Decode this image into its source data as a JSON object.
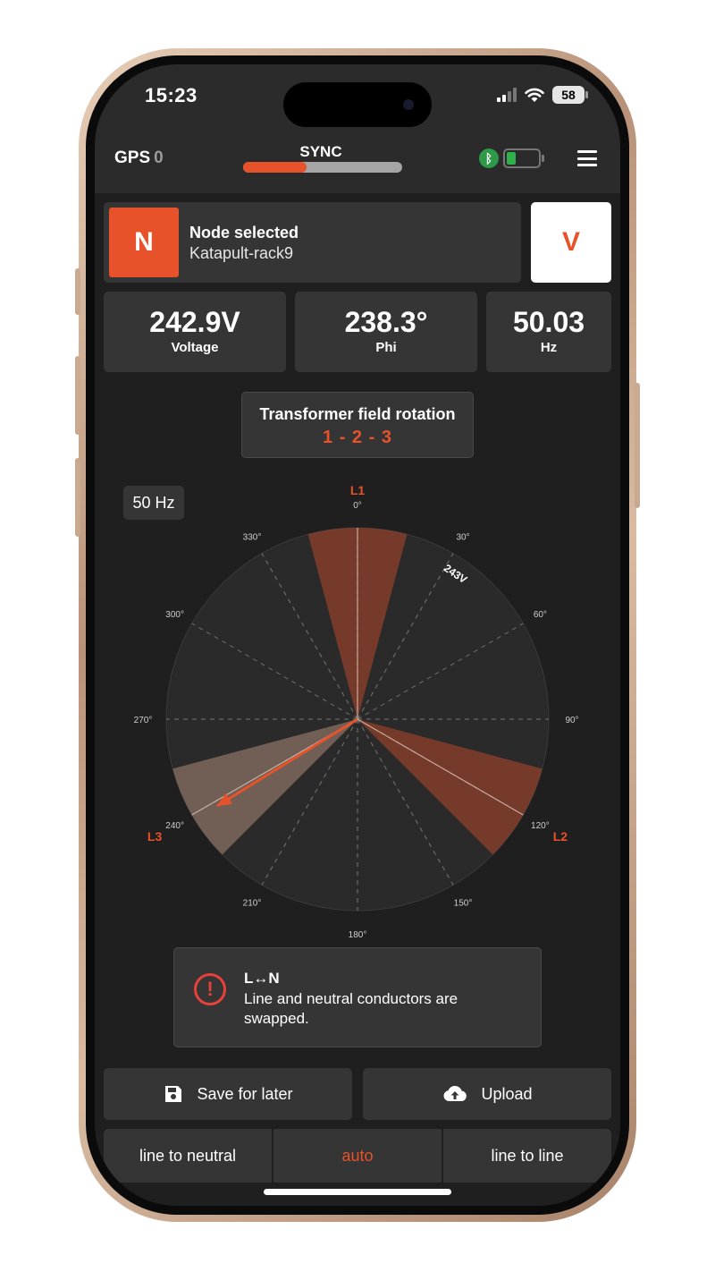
{
  "status_bar": {
    "time": "15:23",
    "battery_percent": "58"
  },
  "header": {
    "gps_label": "GPS",
    "gps_value": "0",
    "sync_label": "SYNC",
    "sync_progress": 0.4,
    "device_battery_level": 0.3,
    "bluetooth_icon": "bluetooth-icon",
    "menu_icon": "hamburger-menu-icon"
  },
  "node": {
    "badge": "N",
    "title": "Node selected",
    "name": "Katapult-rack9",
    "mode_button": "V"
  },
  "metrics": [
    {
      "value": "242.9V",
      "label": "Voltage"
    },
    {
      "value": "238.3°",
      "label": "Phi"
    },
    {
      "value": "50.03",
      "label": "Hz"
    }
  ],
  "rotation": {
    "title": "Transformer field rotation",
    "value": "1 - 2 - 3"
  },
  "phasor": {
    "frequency_badge": "50 Hz",
    "voltage_label": "243V",
    "angle_labels": [
      "0°",
      "30°",
      "60°",
      "90°",
      "120°",
      "150°",
      "180°",
      "210°",
      "240°",
      "270°",
      "300°",
      "330°"
    ],
    "phases": [
      {
        "name": "L1",
        "angle_deg": 0,
        "color": "#e8522a"
      },
      {
        "name": "L2",
        "angle_deg": 120,
        "color": "#e8522a"
      },
      {
        "name": "L3",
        "angle_deg": 240,
        "color": "#e8522a"
      }
    ],
    "measured_angle_deg": 238.3,
    "measured_magnitude_fraction": 0.96
  },
  "alert": {
    "icon": "alert-circle-icon",
    "title": "L↔N",
    "message": "Line and neutral conductors are swapped."
  },
  "actions": {
    "save_label": "Save for later",
    "save_icon": "floppy-disk-icon",
    "upload_label": "Upload",
    "upload_icon": "cloud-upload-icon"
  },
  "segments": [
    {
      "label": "line to neutral",
      "active": false
    },
    {
      "label": "auto",
      "active": true
    },
    {
      "label": "line to line",
      "active": false
    }
  ],
  "colors": {
    "accent": "#e8522a",
    "panel": "#353535",
    "background": "#1f1f1f",
    "alert": "#e8413c",
    "ok_green": "#2fb24a"
  }
}
